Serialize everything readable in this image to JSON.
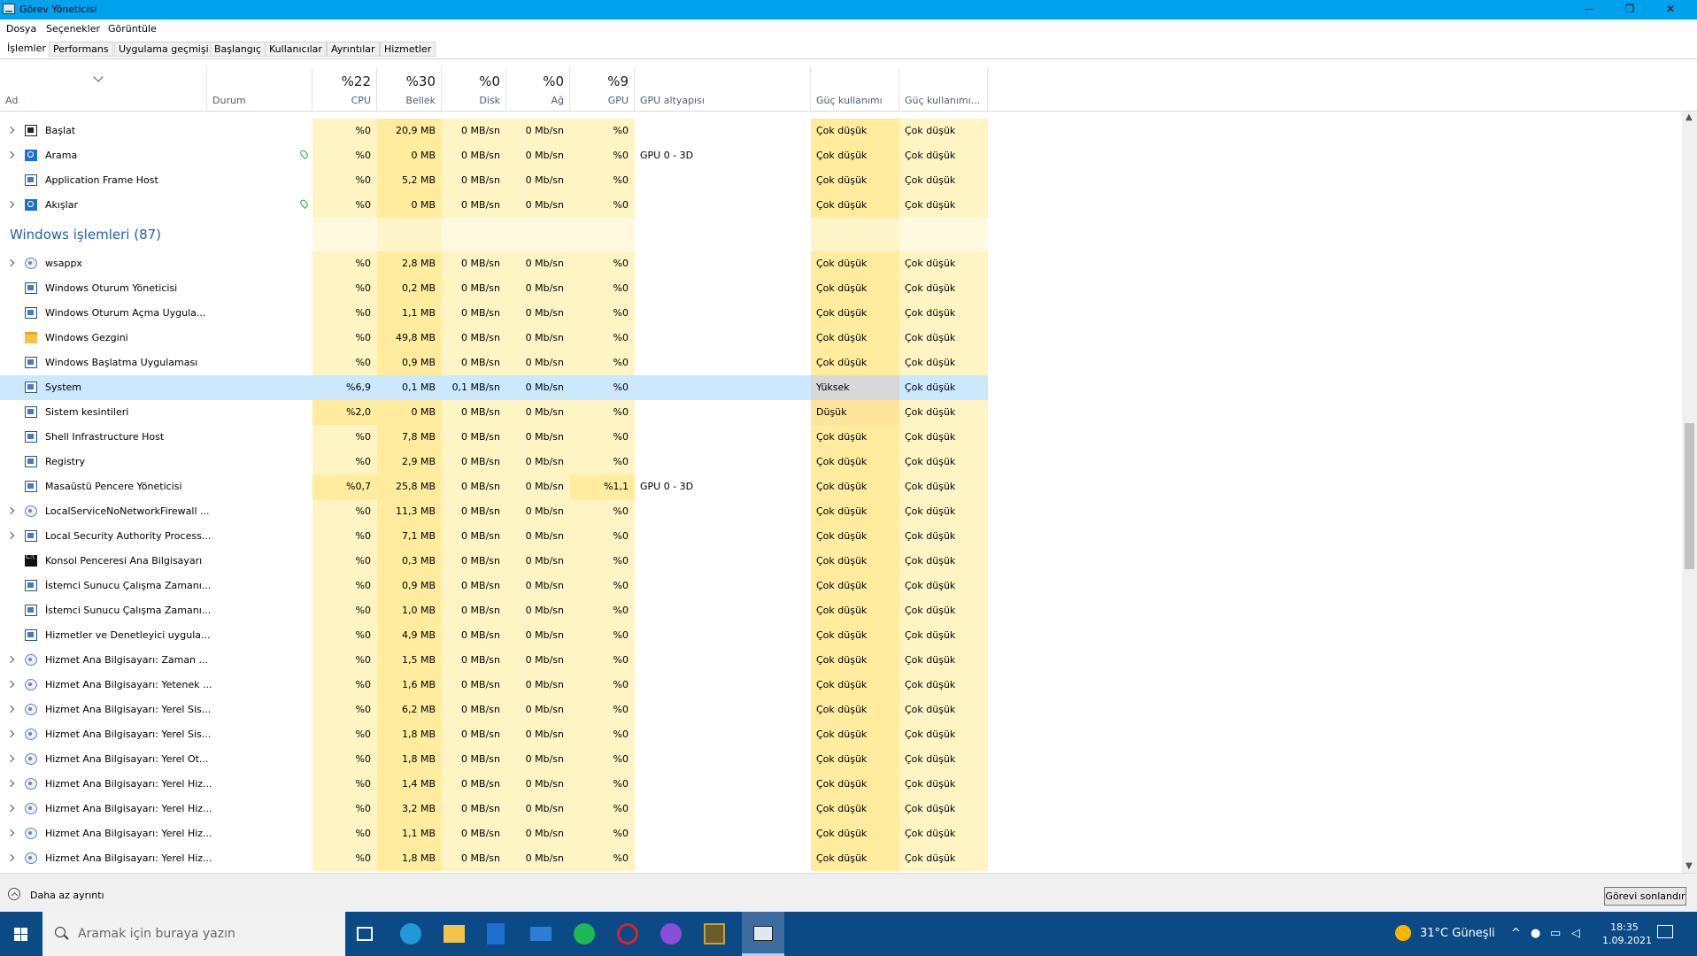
{
  "window": {
    "title": "Görev Yöneticisi",
    "min_glyph": "—",
    "max_glyph": "❐",
    "close_glyph": "✕"
  },
  "menu": [
    "Dosya",
    "Seçenekler",
    "Görüntüle"
  ],
  "tabs": [
    "İşlemler",
    "Performans",
    "Uygulama geçmişi",
    "Başlangıç",
    "Kullanıcılar",
    "Ayrıntılar",
    "Hizmetler"
  ],
  "columns": {
    "name": "Ad",
    "status": "Durum",
    "cpu": {
      "pct": "%22",
      "label": "CPU"
    },
    "mem": {
      "pct": "%30",
      "label": "Bellek"
    },
    "disk": {
      "pct": "%0",
      "label": "Disk"
    },
    "net": {
      "pct": "%0",
      "label": "Ağ"
    },
    "gpu": {
      "pct": "%9",
      "label": "GPU"
    },
    "gpu_engine": "GPU altyapısı",
    "power": "Güç kullanımı",
    "power_trend": "Güç kullanımı..."
  },
  "group": {
    "label": "Windows işlemleri (87)"
  },
  "apps_rows": [
    {
      "name": "Başlat",
      "icon": "start-icon",
      "exp": true,
      "leaf": false,
      "cpu": "%0",
      "mem": "20,9 MB",
      "disk": "0 MB/sn",
      "net": "0 Mb/sn",
      "gpu": "%0",
      "eng": "",
      "pw": "Çok düşük",
      "pwt": "Çok düşük"
    },
    {
      "name": "Arama",
      "icon": "search-icon",
      "exp": true,
      "leaf": true,
      "cpu": "%0",
      "mem": "0 MB",
      "disk": "0 MB/sn",
      "net": "0 Mb/sn",
      "gpu": "%0",
      "eng": "GPU 0 - 3D",
      "pw": "Çok düşük",
      "pwt": "Çok düşük"
    },
    {
      "name": "Application Frame Host",
      "icon": "window-icon",
      "exp": false,
      "leaf": false,
      "cpu": "%0",
      "mem": "5,2 MB",
      "disk": "0 MB/sn",
      "net": "0 Mb/sn",
      "gpu": "%0",
      "eng": "",
      "pw": "Çok düşük",
      "pwt": "Çok düşük"
    },
    {
      "name": "Akışlar",
      "icon": "search-icon",
      "exp": true,
      "leaf": true,
      "cpu": "%0",
      "mem": "0 MB",
      "disk": "0 MB/sn",
      "net": "0 Mb/sn",
      "gpu": "%0",
      "eng": "",
      "pw": "Çok düşük",
      "pwt": "Çok düşük"
    }
  ],
  "win_rows": [
    {
      "name": "wsappx",
      "icon": "gear-icon",
      "exp": true,
      "cpu": "%0",
      "mem": "2,8 MB",
      "disk": "0 MB/sn",
      "net": "0 Mb/sn",
      "gpu": "%0",
      "eng": "",
      "pw": "Çok düşük",
      "pwt": "Çok düşük"
    },
    {
      "name": "Windows Oturum Yöneticisi",
      "icon": "window-icon",
      "exp": false,
      "cpu": "%0",
      "mem": "0,2 MB",
      "disk": "0 MB/sn",
      "net": "0 Mb/sn",
      "gpu": "%0",
      "eng": "",
      "pw": "Çok düşük",
      "pwt": "Çok düşük"
    },
    {
      "name": "Windows Oturum Açma Uygula...",
      "icon": "window-icon",
      "exp": false,
      "cpu": "%0",
      "mem": "1,1 MB",
      "disk": "0 MB/sn",
      "net": "0 Mb/sn",
      "gpu": "%0",
      "eng": "",
      "pw": "Çok düşük",
      "pwt": "Çok düşük"
    },
    {
      "name": "Windows Gezgini",
      "icon": "folder-icon",
      "exp": false,
      "cpu": "%0",
      "mem": "49,8 MB",
      "disk": "0 MB/sn",
      "net": "0 Mb/sn",
      "gpu": "%0",
      "eng": "",
      "pw": "Çok düşük",
      "pwt": "Çok düşük"
    },
    {
      "name": "Windows Başlatma Uygulaması",
      "icon": "window-icon",
      "exp": false,
      "cpu": "%0",
      "mem": "0,9 MB",
      "disk": "0 MB/sn",
      "net": "0 Mb/sn",
      "gpu": "%0",
      "eng": "",
      "pw": "Çok düşük",
      "pwt": "Çok düşük"
    },
    {
      "name": "System",
      "icon": "window-icon",
      "exp": false,
      "sel": true,
      "cpu": "%6,9",
      "mem": "0,1 MB",
      "disk": "0,1 MB/sn",
      "net": "0 Mb/sn",
      "gpu": "%0",
      "eng": "",
      "pw": "Yüksek",
      "pwt": "Çok düşük",
      "pwc": "high"
    },
    {
      "name": "Sistem kesintileri",
      "icon": "window-icon",
      "exp": false,
      "cpu": "%2,0",
      "mem": "0 MB",
      "disk": "0 MB/sn",
      "net": "0 Mb/sn",
      "gpu": "%0",
      "eng": "",
      "pw": "Düşük",
      "pwt": "Çok düşük",
      "pwc": "low",
      "cpuhot": true
    },
    {
      "name": "Shell Infrastructure Host",
      "icon": "window-icon",
      "exp": false,
      "cpu": "%0",
      "mem": "7,8 MB",
      "disk": "0 MB/sn",
      "net": "0 Mb/sn",
      "gpu": "%0",
      "eng": "",
      "pw": "Çok düşük",
      "pwt": "Çok düşük"
    },
    {
      "name": "Registry",
      "icon": "window-icon",
      "exp": false,
      "cpu": "%0",
      "mem": "2,9 MB",
      "disk": "0 MB/sn",
      "net": "0 Mb/sn",
      "gpu": "%0",
      "eng": "",
      "pw": "Çok düşük",
      "pwt": "Çok düşük"
    },
    {
      "name": "Masaüstü Pencere Yöneticisi",
      "icon": "window-icon",
      "exp": false,
      "cpu": "%0,7",
      "mem": "25,8 MB",
      "disk": "0 MB/sn",
      "net": "0 Mb/sn",
      "gpu": "%1,1",
      "eng": "GPU 0 - 3D",
      "pw": "Çok düşük",
      "pwt": "Çok düşük",
      "cpuhot": true,
      "gpuhot": true
    },
    {
      "name": "LocalServiceNoNetworkFirewall ...",
      "icon": "gear-icon",
      "exp": true,
      "cpu": "%0",
      "mem": "11,3 MB",
      "disk": "0 MB/sn",
      "net": "0 Mb/sn",
      "gpu": "%0",
      "eng": "",
      "pw": "Çok düşük",
      "pwt": "Çok düşük"
    },
    {
      "name": "Local Security Authority Process...",
      "icon": "window-icon",
      "exp": true,
      "cpu": "%0",
      "mem": "7,1 MB",
      "disk": "0 MB/sn",
      "net": "0 Mb/sn",
      "gpu": "%0",
      "eng": "",
      "pw": "Çok düşük",
      "pwt": "Çok düşük"
    },
    {
      "name": "Konsol Penceresi Ana Bilgisayarı",
      "icon": "console-icon",
      "exp": false,
      "cpu": "%0",
      "mem": "0,3 MB",
      "disk": "0 MB/sn",
      "net": "0 Mb/sn",
      "gpu": "%0",
      "eng": "",
      "pw": "Çok düşük",
      "pwt": "Çok düşük"
    },
    {
      "name": "İstemci Sunucu Çalışma Zamanı...",
      "icon": "window-icon",
      "exp": false,
      "cpu": "%0",
      "mem": "0,9 MB",
      "disk": "0 MB/sn",
      "net": "0 Mb/sn",
      "gpu": "%0",
      "eng": "",
      "pw": "Çok düşük",
      "pwt": "Çok düşük"
    },
    {
      "name": "İstemci Sunucu Çalışma Zamanı...",
      "icon": "window-icon",
      "exp": false,
      "cpu": "%0",
      "mem": "1,0 MB",
      "disk": "0 MB/sn",
      "net": "0 Mb/sn",
      "gpu": "%0",
      "eng": "",
      "pw": "Çok düşük",
      "pwt": "Çok düşük"
    },
    {
      "name": "Hizmetler ve Denetleyici uygula...",
      "icon": "window-icon",
      "exp": false,
      "cpu": "%0",
      "mem": "4,9 MB",
      "disk": "0 MB/sn",
      "net": "0 Mb/sn",
      "gpu": "%0",
      "eng": "",
      "pw": "Çok düşük",
      "pwt": "Çok düşük"
    },
    {
      "name": "Hizmet Ana Bilgisayarı: Zaman ...",
      "icon": "gear-icon",
      "exp": true,
      "cpu": "%0",
      "mem": "1,5 MB",
      "disk": "0 MB/sn",
      "net": "0 Mb/sn",
      "gpu": "%0",
      "eng": "",
      "pw": "Çok düşük",
      "pwt": "Çok düşük"
    },
    {
      "name": "Hizmet Ana Bilgisayarı: Yetenek ...",
      "icon": "gear-icon",
      "exp": true,
      "cpu": "%0",
      "mem": "1,6 MB",
      "disk": "0 MB/sn",
      "net": "0 Mb/sn",
      "gpu": "%0",
      "eng": "",
      "pw": "Çok düşük",
      "pwt": "Çok düşük"
    },
    {
      "name": "Hizmet Ana Bilgisayarı: Yerel Sis...",
      "icon": "gear-icon",
      "exp": true,
      "cpu": "%0",
      "mem": "6,2 MB",
      "disk": "0 MB/sn",
      "net": "0 Mb/sn",
      "gpu": "%0",
      "eng": "",
      "pw": "Çok düşük",
      "pwt": "Çok düşük"
    },
    {
      "name": "Hizmet Ana Bilgisayarı: Yerel Sis...",
      "icon": "gear-icon",
      "exp": true,
      "cpu": "%0",
      "mem": "1,8 MB",
      "disk": "0 MB/sn",
      "net": "0 Mb/sn",
      "gpu": "%0",
      "eng": "",
      "pw": "Çok düşük",
      "pwt": "Çok düşük"
    },
    {
      "name": "Hizmet Ana Bilgisayarı: Yerel Ot...",
      "icon": "gear-icon",
      "exp": true,
      "cpu": "%0",
      "mem": "1,8 MB",
      "disk": "0 MB/sn",
      "net": "0 Mb/sn",
      "gpu": "%0",
      "eng": "",
      "pw": "Çok düşük",
      "pwt": "Çok düşük"
    },
    {
      "name": "Hizmet Ana Bilgisayarı: Yerel Hiz...",
      "icon": "gear-icon",
      "exp": true,
      "cpu": "%0",
      "mem": "1,4 MB",
      "disk": "0 MB/sn",
      "net": "0 Mb/sn",
      "gpu": "%0",
      "eng": "",
      "pw": "Çok düşük",
      "pwt": "Çok düşük"
    },
    {
      "name": "Hizmet Ana Bilgisayarı: Yerel Hiz...",
      "icon": "gear-icon",
      "exp": true,
      "cpu": "%0",
      "mem": "3,2 MB",
      "disk": "0 MB/sn",
      "net": "0 Mb/sn",
      "gpu": "%0",
      "eng": "",
      "pw": "Çok düşük",
      "pwt": "Çok düşük"
    },
    {
      "name": "Hizmet Ana Bilgisayarı: Yerel Hiz...",
      "icon": "gear-icon",
      "exp": true,
      "cpu": "%0",
      "mem": "1,1 MB",
      "disk": "0 MB/sn",
      "net": "0 Mb/sn",
      "gpu": "%0",
      "eng": "",
      "pw": "Çok düşük",
      "pwt": "Çok düşük"
    },
    {
      "name": "Hizmet Ana Bilgisayarı: Yerel Hiz...",
      "icon": "gear-icon",
      "exp": true,
      "cpu": "%0",
      "mem": "1,8 MB",
      "disk": "0 MB/sn",
      "net": "0 Mb/sn",
      "gpu": "%0",
      "eng": "",
      "pw": "Çok düşük",
      "pwt": "Çok düşük"
    }
  ],
  "footer": {
    "fewer_details": "Daha az ayrıntı",
    "end_task": "Görevi sonlandır"
  },
  "taskbar": {
    "search_placeholder": "Aramak için buraya yazın",
    "weather": "31°C  Güneşli",
    "time": "18:35",
    "date": "1.09.2021"
  }
}
